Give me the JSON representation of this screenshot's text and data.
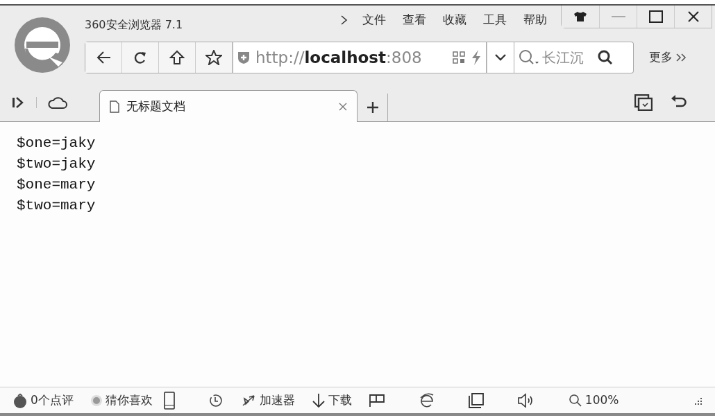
{
  "window": {
    "title": "360安全浏览器 7.1"
  },
  "menu": [
    "文件",
    "查看",
    "收藏",
    "工具",
    "帮助"
  ],
  "more": "更多",
  "address": {
    "url": "http://**localhost**:808"
  },
  "search": {
    "placeholder": "长江沉"
  },
  "tabs": [
    {
      "label": "无标题文档",
      "selected": true
    }
  ],
  "content": {
    "lines": [
      "$one=jaky",
      "$two=jaky",
      "$one=mary",
      "$two=mary"
    ]
  },
  "status_bar": {
    "reviews": "0个点评",
    "guess": "猜你喜欢",
    "accelerator": "加速器",
    "download": "下载",
    "zoom": "100%"
  }
}
